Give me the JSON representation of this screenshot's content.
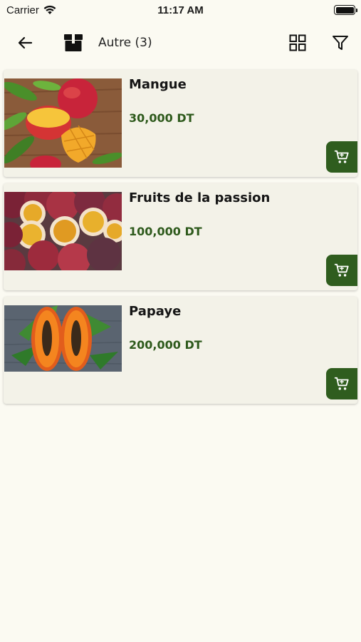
{
  "status_bar": {
    "carrier": "Carrier",
    "time": "11:17 AM"
  },
  "toolbar": {
    "title": "Autre (3)"
  },
  "products": [
    {
      "name": "Mangue",
      "price": "30,000 DT"
    },
    {
      "name": "Fruits de la passion",
      "price": "100,000 DT"
    },
    {
      "name": "Papaye",
      "price": "200,000 DT"
    }
  ],
  "colors": {
    "background": "#fbfaf2",
    "card": "#f3f2e8",
    "accent": "#2f5d1e",
    "price": "#2e5a1c"
  },
  "icons": {
    "back": "arrow-left-icon",
    "category": "box-icon",
    "grid": "grid-view-icon",
    "filter": "filter-icon",
    "cart": "cart-icon"
  }
}
